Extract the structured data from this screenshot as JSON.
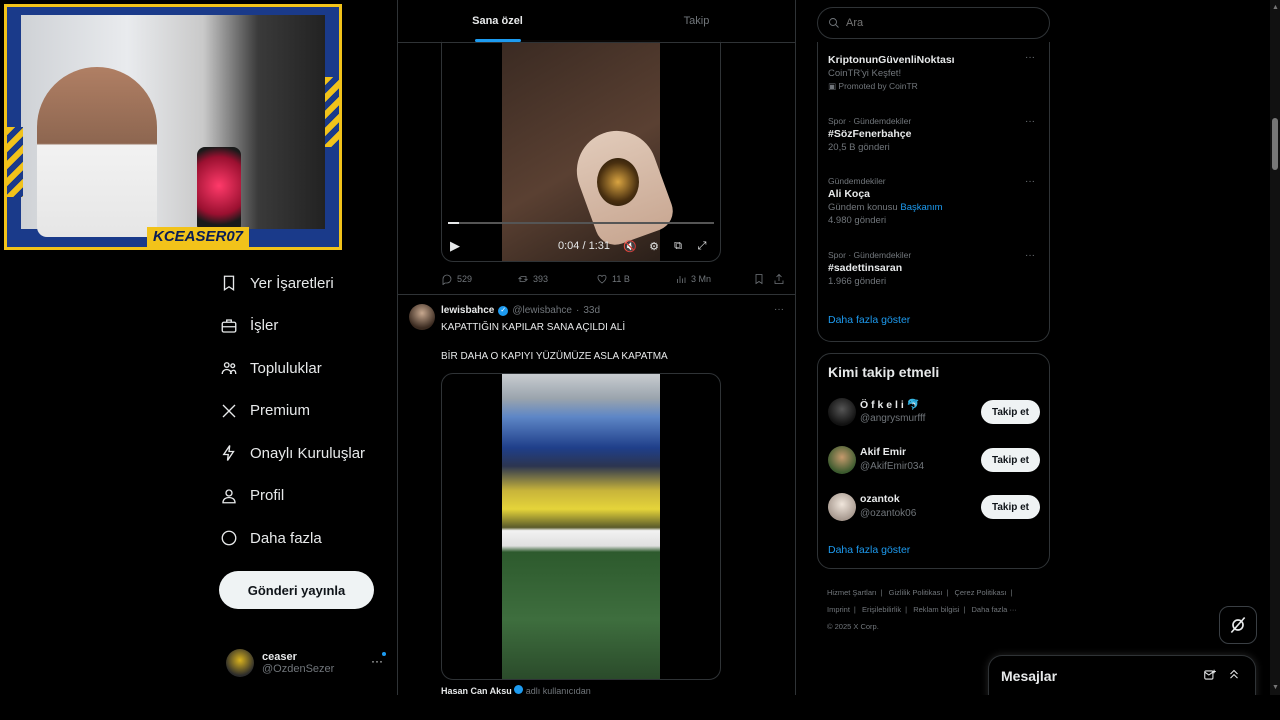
{
  "webcam": {
    "tag": "KCEASER07"
  },
  "nav": {
    "items": [
      {
        "label": "Yer İşaretleri",
        "icon": "bookmark-icon"
      },
      {
        "label": "İşler",
        "icon": "briefcase-icon"
      },
      {
        "label": "Topluluklar",
        "icon": "communities-icon"
      },
      {
        "label": "Premium",
        "icon": "x-logo-icon"
      },
      {
        "label": "Onaylı Kuruluşlar",
        "icon": "lightning-icon"
      },
      {
        "label": "Profil",
        "icon": "profile-icon"
      },
      {
        "label": "Daha fazla",
        "icon": "more-circle-icon"
      }
    ],
    "post_label": "Gönderi yayınla",
    "account": {
      "name": "ceaser",
      "handle": "@OzdenSezer"
    }
  },
  "tabs": [
    {
      "label": "Sana özel",
      "active": true
    },
    {
      "label": "Takip",
      "active": false
    }
  ],
  "tweet1": {
    "video": {
      "time": "0:04 / 1:31",
      "progress": 0.04
    },
    "actions": {
      "replies": "529",
      "reposts": "393",
      "likes": "11 B",
      "views": "3 Mn"
    }
  },
  "tweet2": {
    "name": "lewisbahce",
    "handle": "@lewisbahce",
    "age": "33d",
    "line1": "KAPATTIĞIN KAPILAR SANA AÇILDI ALİ",
    "line2": "BİR DAHA O KAPIYI YÜZÜMÜZE ASLA KAPATMA",
    "hint_name": "Hasan Can Aksu",
    "hint_text": "adlı kullanıcıdan"
  },
  "search": {
    "placeholder": "Ara"
  },
  "trends": [
    {
      "meta": "",
      "title": "KriptonunGüvenliNoktası",
      "sub": "CoinTR'yi Keşfet!",
      "extra": "Promoted by CoinTR"
    },
    {
      "meta": "Spor · Gündemdekiler",
      "title": "#SözFenerbahçe",
      "sub": "20,5 B gönderi"
    },
    {
      "meta": "Gündemdekiler",
      "title": "Ali Koça",
      "sub_prefix": "Gündem konusu",
      "sub_link": "Başkanım",
      "sub2": "4.980 gönderi"
    },
    {
      "meta": "Spor · Gündemdekiler",
      "title": "#sadettinsaran",
      "sub": "1.966 gönderi"
    }
  ],
  "trends_more": "Daha fazla göster",
  "who_to_follow": {
    "title": "Kimi takip etmeli",
    "users": [
      {
        "name": "Ö f k e l i 🐬",
        "handle": "@angrysmurfff",
        "button": "Takip et"
      },
      {
        "name": "Akif Emir",
        "handle": "@AkifEmir034",
        "button": "Takip et"
      },
      {
        "name": "ozantok",
        "handle": "@ozantok06",
        "button": "Takip et"
      }
    ],
    "more": "Daha fazla göster"
  },
  "footer": {
    "links": [
      "Hizmet Şartları",
      "|",
      "Gizlilik Politikası",
      "|",
      "Çerez Politikası",
      "|",
      "Imprint",
      "|",
      "Erişilebilirlik",
      "|",
      "Reklam bilgisi",
      "|",
      "Daha fazla ···"
    ],
    "copyright": "© 2025 X Corp."
  },
  "messages": {
    "title": "Mesajlar"
  }
}
